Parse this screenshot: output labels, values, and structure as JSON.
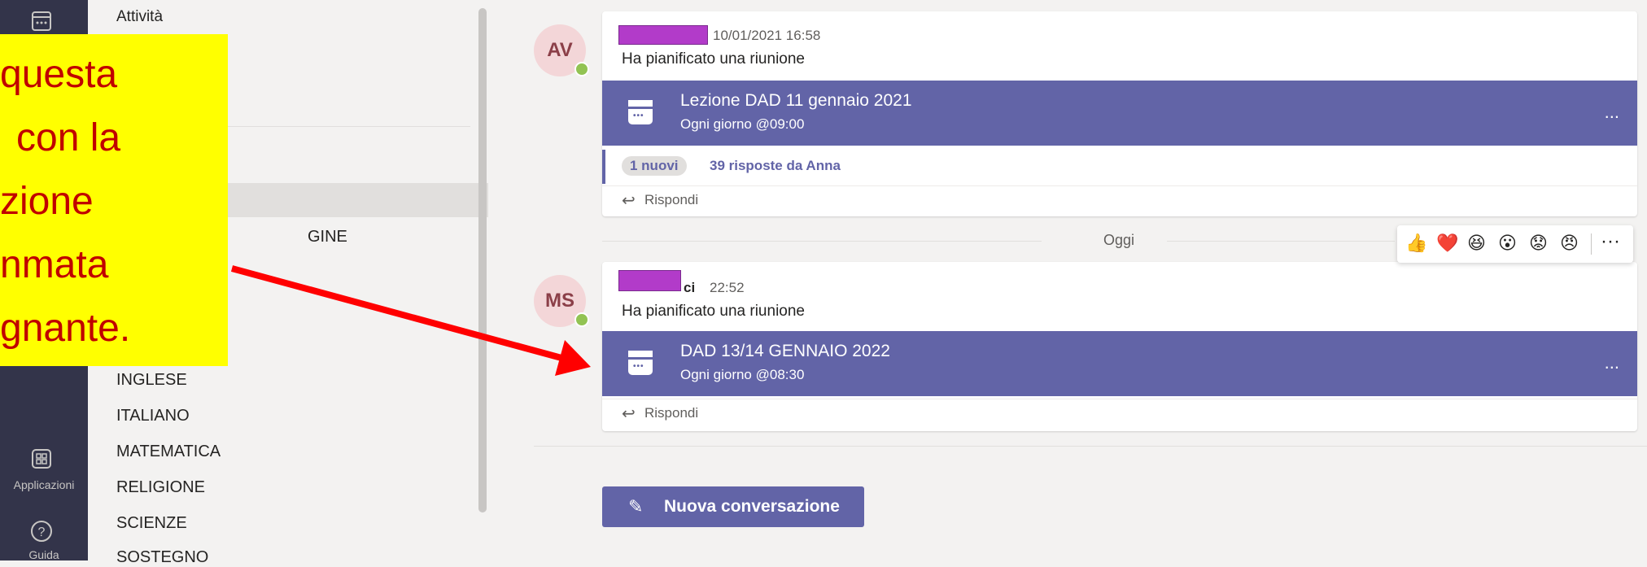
{
  "app_rail": {
    "apps_label": "Applicazioni",
    "help_label": "Guida",
    "colors": {
      "rail": "#33344a"
    }
  },
  "channel_panel": {
    "top_item": "Attività",
    "partial_item": "GINE",
    "channels": [
      "INGLESE",
      "ITALIANO",
      "MATEMATICA",
      "RELIGIONE",
      "SCIENZE",
      "SOSTEGNO"
    ]
  },
  "feed": {
    "post1": {
      "initials": "AV",
      "timestamp": "10/01/2021 16:58",
      "text": "Ha pianificato una riunione",
      "meeting_title": "Lezione DAD 11 gennaio 2021",
      "meeting_schedule": "Ogni giorno @09:00",
      "more": "...",
      "new_badge": "1 nuovi",
      "replies": "39 risposte da Anna",
      "reply_label": "Rispondi"
    },
    "day_divider": "Oggi",
    "post2": {
      "initials": "MS",
      "author_partial": "ci",
      "timestamp": "22:52",
      "text": "Ha pianificato una riunione",
      "meeting_title": "DAD 13/14 GENNAIO 2022",
      "meeting_schedule": "Ogni giorno @08:30",
      "more": "...",
      "reply_label": "Rispondi"
    },
    "reactions": [
      "👍",
      "❤️",
      "😆",
      "😮",
      "😟",
      "😠"
    ],
    "reactions_more": "···",
    "new_conversation": "Nuova conversazione",
    "colors": {
      "accent": "#6264a7",
      "presence": "#92c353"
    }
  },
  "callout": {
    "lines": [
      "questa",
      "con la",
      "zione",
      "nmata",
      "gnante."
    ],
    "colors": {
      "background": "#ffff00",
      "text": "#c00000",
      "arrow": "#ff0000"
    }
  }
}
